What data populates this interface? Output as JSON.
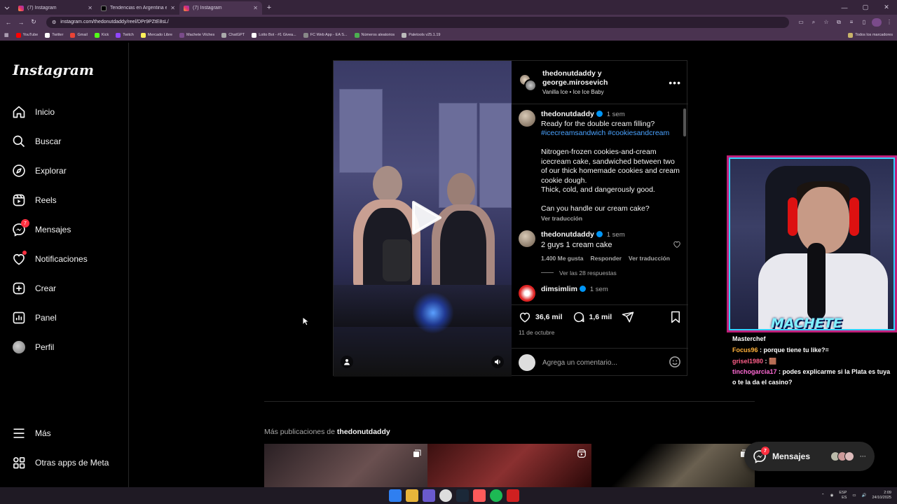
{
  "browser": {
    "tabs": [
      {
        "title": "(7) Instagram",
        "favicon": "instagram"
      },
      {
        "title": "Tendencias en Argentina en X",
        "favicon": "x"
      },
      {
        "title": "(7) Instagram",
        "favicon": "instagram",
        "active": true
      }
    ],
    "url": "instagram.com/thedonutdaddy/reel/DPr9PZtE8sL/",
    "bookmarks": [
      "YouTube",
      "Twitter",
      "Gmail",
      "Kick",
      "Twitch",
      "Mercado Libre",
      "Machete Vilches",
      "ChatGPT",
      "Lotto Bot - #1 Givea...",
      "FC Web App - EA S...",
      "Números aleatorios",
      "Paletools v25.1.19"
    ],
    "bookmark_colors": [
      "#ff0000",
      "#ffffff",
      "#ea4335",
      "#53fc18",
      "#9146ff",
      "#fff159",
      "#7a4b8a",
      "#aaaaaa",
      "#ffffff",
      "#888888",
      "#4caf50",
      "#bbbbbb"
    ],
    "all_bookmarks": "Todos los marcadores"
  },
  "sidebar": {
    "logo": "Instagram",
    "items": [
      {
        "label": "Inicio",
        "icon": "home-icon"
      },
      {
        "label": "Buscar",
        "icon": "search-icon"
      },
      {
        "label": "Explorar",
        "icon": "compass-icon"
      },
      {
        "label": "Reels",
        "icon": "reels-icon"
      },
      {
        "label": "Mensajes",
        "icon": "messenger-icon",
        "badge": "7"
      },
      {
        "label": "Notificaciones",
        "icon": "heart-icon"
      },
      {
        "label": "Crear",
        "icon": "plus-square-icon"
      },
      {
        "label": "Panel",
        "icon": "chart-icon"
      },
      {
        "label": "Perfil",
        "icon": "avatar"
      }
    ],
    "bottom": [
      {
        "label": "Más",
        "icon": "menu-icon"
      },
      {
        "label": "Otras apps de Meta",
        "icon": "meta-apps-icon"
      }
    ]
  },
  "post": {
    "header": {
      "user1": "thedonutdaddy y",
      "user2": "george.mirosevich",
      "audio": "Vanilla Ice • Ice Ice Baby"
    },
    "caption": {
      "user": "thedonutdaddy",
      "time": "1 sem",
      "line1": "Ready for the double cream filling?",
      "tag1": "#icecreamsandwich",
      "tag2": "#cookiesandcream",
      "body": "Nitrogen-frozen cookies-and-cream icecream cake, sandwiched between two of our thick homemade cookies and cream cookie dough.",
      "body2": "Thick, cold, and dangerously good.",
      "question": "Can you handle our cream cake?",
      "translate": "Ver traducción"
    },
    "comment1": {
      "user": "thedonutdaddy",
      "time": "1 sem",
      "text": "2 guys 1 cream cake",
      "likes": "1.400 Me gusta",
      "reply": "Responder",
      "translate": "Ver traducción",
      "view_replies": "Ver las 28 respuestas"
    },
    "comment2": {
      "user": "dimsimlim",
      "time": "1 sem"
    },
    "likes": "36,6 mil",
    "comments_count": "1,6 mil",
    "date": "11 de octubre",
    "add_comment_placeholder": "Agrega un comentario..."
  },
  "more_posts": {
    "prefix": "Más publicaciones de",
    "user": "thedonutdaddy"
  },
  "stream": {
    "overlay_name": "MACHETE",
    "chat": [
      {
        "user": "Masterchef",
        "text": ""
      },
      {
        "user": "Focus96",
        "text": "porque tiene tu like?="
      },
      {
        "user": "grisel1980",
        "text": "🟫"
      },
      {
        "user": "tinchogarcia17",
        "text": "podes explicarme si la Plata es tuya o te la da el casino?"
      }
    ]
  },
  "messages_pill": {
    "label": "Mensajes",
    "badge": "7"
  },
  "taskbar": {
    "lang": "ESP",
    "lang2": "ES",
    "time": "2:09",
    "date": "24/10/2025"
  }
}
